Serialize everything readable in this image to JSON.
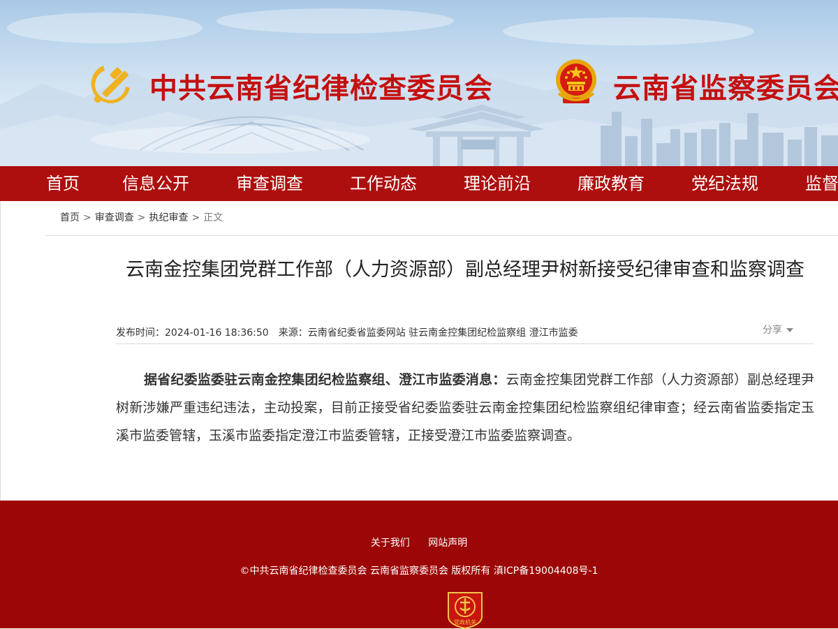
{
  "header": {
    "left_title": "中共云南省纪律检查委员会",
    "right_title": "云南省监察委员会"
  },
  "nav": {
    "items": [
      "首页",
      "信息公开",
      "审查调查",
      "工作动态",
      "理论前沿",
      "廉政教育",
      "党纪法规",
      "监督"
    ]
  },
  "breadcrumb": {
    "items": [
      "首页",
      "审查调查",
      "执纪审查"
    ],
    "separator": ">",
    "current": "正文"
  },
  "article": {
    "title": "云南金控集团党群工作部（人力资源部）副总经理尹树新接受纪律审查和监察调查",
    "publish_label": "发布时间：",
    "publish_time": "2024-01-16 18:36:50",
    "source_label": "来源：",
    "source": "云南省纪委省监委网站 驻云南金控集团纪检监察组 澄江市监委",
    "share_label": "分享",
    "lead": "据省纪委监委驻云南金控集团纪检监察组、澄江市监委消息：",
    "body": "云南金控集团党群工作部（人力资源部）副总经理尹树新涉嫌严重违纪违法，主动投案，目前正接受省纪委监委驻云南金控集团纪检监察组纪律审查；经云南省监委指定玉溪市监委管辖，玉溪市监委指定澄江市监委管辖，正接受澄江市监委监察调查。"
  },
  "footer": {
    "links": [
      "关于我们",
      "网站声明"
    ],
    "copyright": "©中共云南省纪律检查委员会 云南省监察委员会 版权所有 滇ICP备19004408号-1",
    "badge_text": "党政机关"
  },
  "colors": {
    "brand_red": "#c4100f",
    "nav_red": "#ad0f0e",
    "footer_red": "#9c0606",
    "emblem_gold": "#f0b21f"
  }
}
